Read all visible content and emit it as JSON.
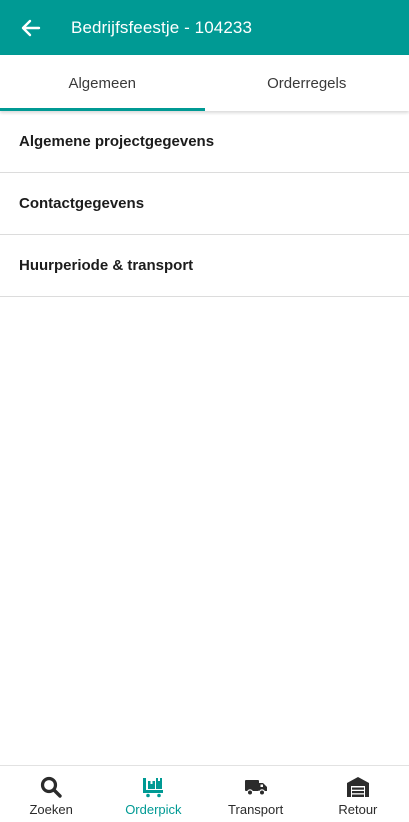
{
  "header": {
    "title": "Bedrijfsfeestje - 104233",
    "back_icon": "arrow-left-icon",
    "background": "#009a94"
  },
  "tabs": [
    {
      "label": "Algemeen",
      "active": true
    },
    {
      "label": "Orderregels",
      "active": false
    }
  ],
  "sections": [
    {
      "label": "Algemene projectgegevens"
    },
    {
      "label": "Contactgegevens"
    },
    {
      "label": "Huurperiode & transport"
    }
  ],
  "bottom_nav": [
    {
      "label": "Zoeken",
      "icon": "search-icon",
      "active": false
    },
    {
      "label": "Orderpick",
      "icon": "pallet-icon",
      "active": true
    },
    {
      "label": "Transport",
      "icon": "truck-icon",
      "active": false
    },
    {
      "label": "Retour",
      "icon": "warehouse-icon",
      "active": false
    }
  ],
  "colors": {
    "accent": "#009a94"
  }
}
